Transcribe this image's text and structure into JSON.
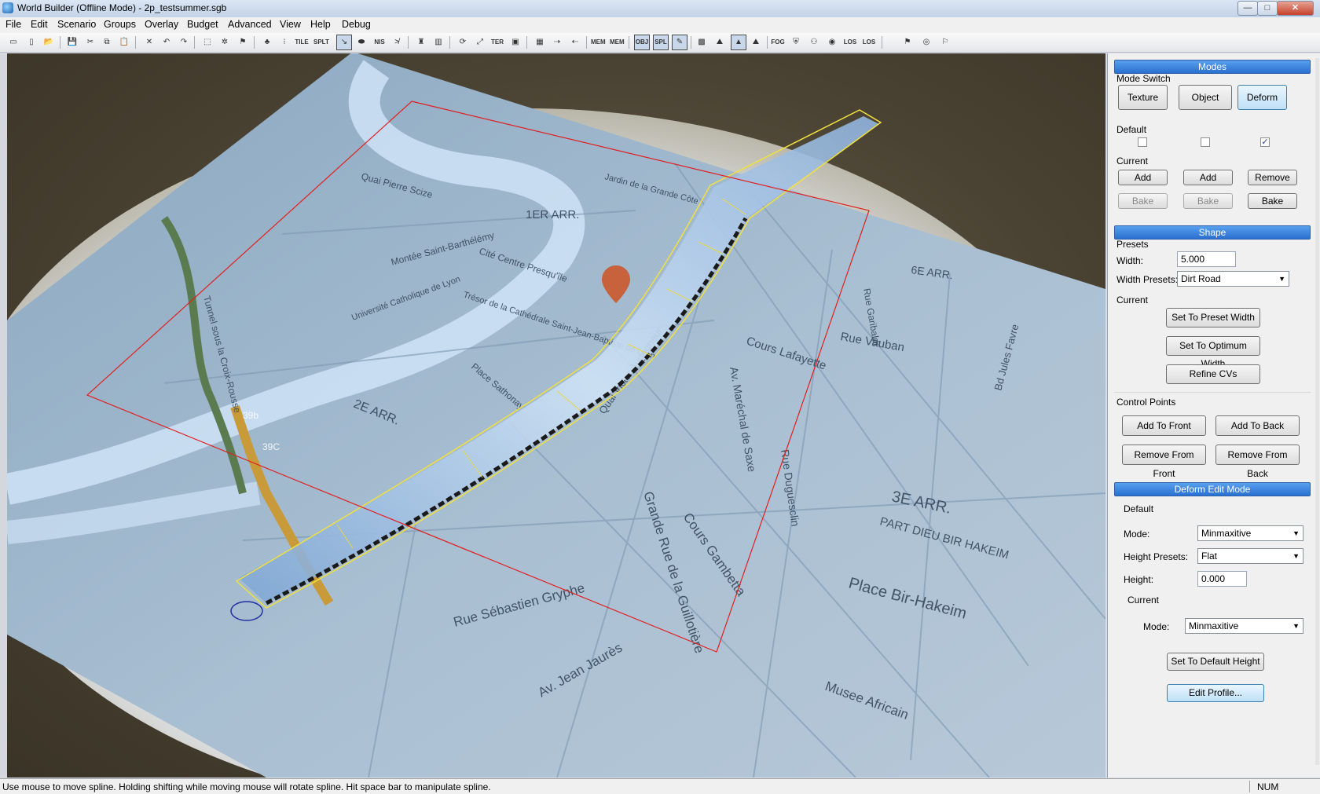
{
  "window": {
    "title": "World Builder (Offline Mode) - 2p_testsummer.sgb",
    "min": "—",
    "max": "□",
    "close": "✕"
  },
  "menu": [
    "File",
    "Edit",
    "Scenario",
    "Groups",
    "Overlay",
    "Budget",
    "Advanced",
    "View",
    "Help",
    "Debug"
  ],
  "toolbar": {
    "tile": "TILE",
    "split": "SPLT",
    "nis": "NIS",
    "ter": "TER",
    "mem1": "MEM",
    "mem2": "MEM",
    "obj": "OBJ",
    "spl": "SPL",
    "fog": "FOG",
    "los1": "LOS",
    "los2": "LOS"
  },
  "map_labels": {
    "arr1": "1ER ARR.",
    "arr2": "2E ARR.",
    "arr3": "3E ARR.",
    "arr6": "6E ARR.",
    "quai_pierre": "Quai Pierre Scize",
    "jardin": "Jardin de la Grande Côte",
    "montee": "Montée Saint-Barthélémy",
    "cite": "Cité Centre Presqu'île",
    "tresor": "Trésor de la Cathédrale Saint-Jean-Baptiste de Lyon",
    "univ": "Université Catholique de Lyon",
    "place_sathonay": "Place Sathonay",
    "cours_lafayette": "Cours Lafayette",
    "rue_vauban": "Rue Vauban",
    "av_marechal": "Av. Maréchal de Saxe",
    "rue_duguesclin": "Rue Duguesclin",
    "grande_rue": "Grande Rue de la Guillotière",
    "cours_gambetta": "Cours Gambetta",
    "part_dieu": "PART DIEU BIR HAKEIM",
    "place_bir": "Place Bir-Hakeim",
    "rue_sebastien": "Rue Sébastien Gryphe",
    "av_jean_jaures": "Av. Jean Jaurès",
    "musee": "Musee Africain",
    "bd_jules": "Bd Jules Favre",
    "rue_garibaldi": "Rue Garibaldi",
    "quai_victor": "Quai Victor Augagneur",
    "tunnel": "Tunnel sous la Croix-Rousse",
    "exit_b": "39b",
    "exit_c": "39C"
  },
  "panel": {
    "modes": {
      "header": "Modes",
      "switch_label": "Mode Switch",
      "buttons": [
        "Texture",
        "Object",
        "Deform"
      ],
      "default_label": "Default",
      "defaults": [
        "",
        "",
        "✓"
      ],
      "current_label": "Current",
      "add1": "Add",
      "add2": "Add",
      "remove": "Remove",
      "bake1": "Bake",
      "bake2": "Bake",
      "bake3": "Bake"
    },
    "shape": {
      "header": "Shape",
      "presets_label": "Presets",
      "width_label": "Width:",
      "width_value": "5.000",
      "width_presets_label": "Width Presets:",
      "width_preset_value": "Dirt Road",
      "current_label": "Current",
      "set_preset": "Set To Preset Width",
      "set_optimum": "Set To Optimum Width",
      "refine": "Refine CVs",
      "control_points_label": "Control Points",
      "add_front": "Add To Front",
      "add_back": "Add To Back",
      "remove_front": "Remove From Front",
      "remove_back": "Remove From Back"
    },
    "deform": {
      "header": "Deform Edit Mode",
      "default_label": "Default",
      "mode_label": "Mode:",
      "mode_value": "Minmaxitive",
      "height_presets_label": "Height Presets:",
      "height_presets_value": "Flat",
      "height_label": "Height:",
      "height_value": "0.000",
      "current_label": "Current",
      "current_mode_label": "Mode:",
      "current_mode_value": "Minmaxitive",
      "set_default_height": "Set To Default Height",
      "edit_profile": "Edit Profile..."
    }
  },
  "status": {
    "text": "Use mouse to move spline. Holding shifting while moving mouse will rotate spline. Hit space bar to manipulate spline.",
    "num": "NUM"
  },
  "colors": {
    "accent": "#2a6fd0",
    "selection_box": "#e02020",
    "spline": "#f0e040",
    "map": "#9bb8d0"
  }
}
